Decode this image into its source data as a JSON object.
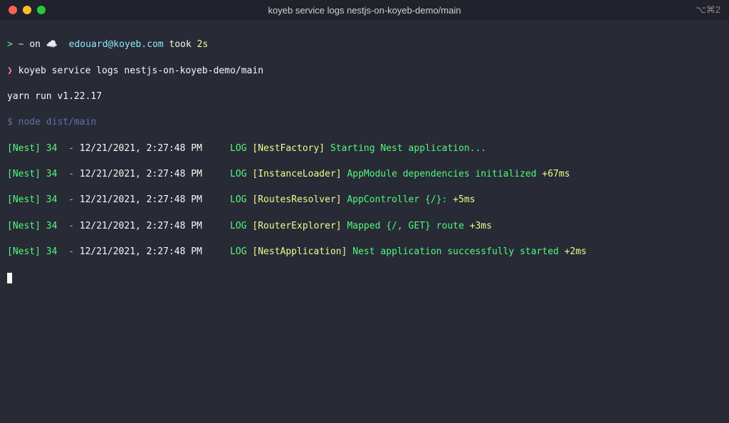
{
  "window": {
    "title": "koyeb service logs nestjs-on-koyeb-demo/main",
    "right_indicator": "⌥⌘2"
  },
  "prompt": {
    "tilde": "~",
    "on": "on",
    "cloud": "☁️",
    "user": "edouard@koyeb.com",
    "took": "took",
    "duration": "2s"
  },
  "commands": {
    "cmd1_prefix": "❯",
    "cmd1": "koyeb service logs nestjs-on-koyeb-demo/main",
    "yarn": "yarn run v1.22.17",
    "node_prefix": "$",
    "node": "node dist/main"
  },
  "logs": [
    {
      "pfx": "[Nest] 34  - ",
      "ts": "12/21/2021, 2:27:48 PM",
      "level": "LOG",
      "module": "[NestFactory]",
      "msg": "Starting Nest application...",
      "suffix": ""
    },
    {
      "pfx": "[Nest] 34  - ",
      "ts": "12/21/2021, 2:27:48 PM",
      "level": "LOG",
      "module": "[InstanceLoader]",
      "msg": "AppModule dependencies initialized",
      "suffix": " +67ms"
    },
    {
      "pfx": "[Nest] 34  - ",
      "ts": "12/21/2021, 2:27:48 PM",
      "level": "LOG",
      "module": "[RoutesResolver]",
      "msg": "AppController {/}:",
      "suffix": " +5ms"
    },
    {
      "pfx": "[Nest] 34  - ",
      "ts": "12/21/2021, 2:27:48 PM",
      "level": "LOG",
      "module": "[RouterExplorer]",
      "msg": "Mapped {/, GET} route",
      "suffix": " +3ms"
    },
    {
      "pfx": "[Nest] 34  - ",
      "ts": "12/21/2021, 2:27:48 PM",
      "level": "LOG",
      "module": "[NestApplication]",
      "msg": "Nest application successfully started",
      "suffix": " +2ms"
    }
  ]
}
